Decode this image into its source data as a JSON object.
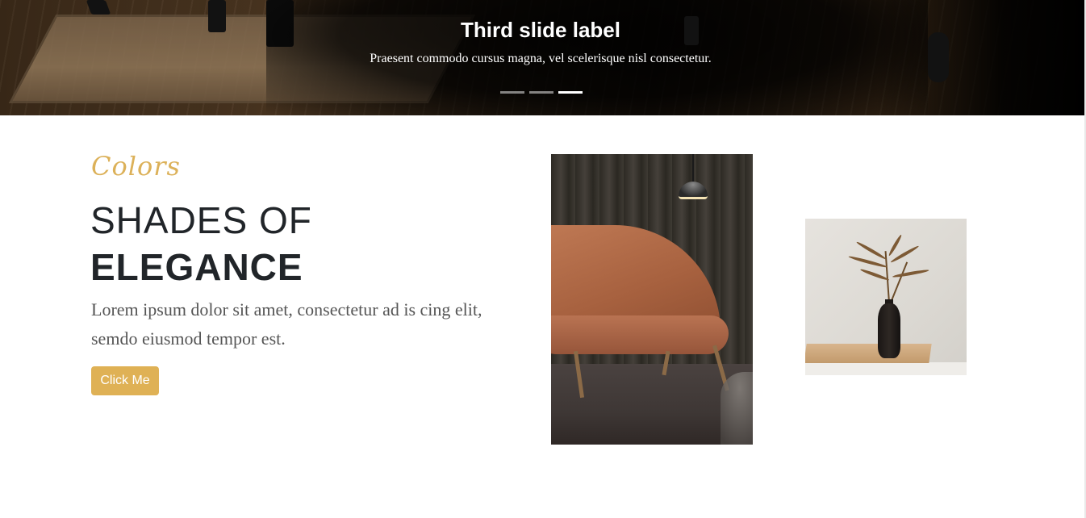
{
  "carousel": {
    "caption_title": "Third slide label",
    "caption_text": "Praesent commodo cursus magna, vel scelerisque nisl consectetur.",
    "slide_count": 3,
    "active_slide": 3
  },
  "section": {
    "eyebrow": "Colors",
    "headline_line1": "SHADES OF",
    "headline_line2": "ELEGANCE",
    "lead": "Lorem ipsum dolor sit amet, consectetur ad is cing elit, semdo eiusmod tempor est.",
    "button_label": "Click Me"
  },
  "colors": {
    "accent": "#dfb155",
    "eyebrow": "#dcb159",
    "heading": "#212529",
    "body_text": "#555555"
  }
}
